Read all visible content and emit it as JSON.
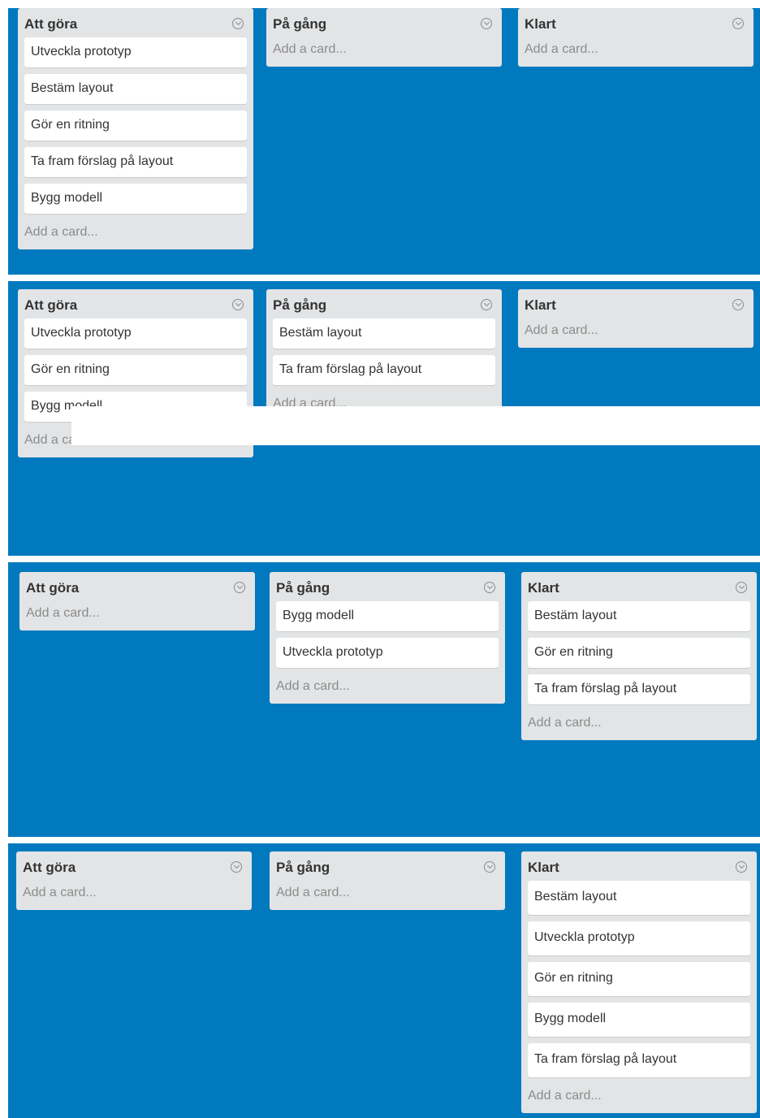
{
  "boards": [
    {
      "lists": [
        {
          "title": "Att göra",
          "cards": [
            "Utveckla prototyp",
            "Bestäm layout",
            "Gör en ritning",
            "Ta fram förslag på layout",
            "Bygg modell"
          ],
          "add": "Add a card..."
        },
        {
          "title": "På gång",
          "cards": [],
          "add": "Add a card..."
        },
        {
          "title": "Klart",
          "cards": [],
          "add": "Add a card..."
        }
      ]
    },
    {
      "lists": [
        {
          "title": "Att göra",
          "cards": [
            "Utveckla prototyp",
            "Gör en ritning",
            "Bygg modell"
          ],
          "add": "Add a card..."
        },
        {
          "title": "På gång",
          "cards": [
            "Bestäm layout",
            "Ta fram förslag på layout"
          ],
          "add": "Add a card..."
        },
        {
          "title": "Klart",
          "cards": [],
          "add": "Add a card..."
        }
      ]
    },
    {
      "lists": [
        {
          "title": "Att göra",
          "cards": [],
          "add": "Add a card..."
        },
        {
          "title": "På gång",
          "cards": [
            "Bygg modell",
            "Utveckla prototyp"
          ],
          "add": "Add a card..."
        },
        {
          "title": "Klart",
          "cards": [
            "Bestäm layout",
            "Gör en ritning",
            "Ta fram förslag på layout"
          ],
          "add": "Add a card..."
        }
      ]
    },
    {
      "lists": [
        {
          "title": "Att göra",
          "cards": [],
          "add": "Add a card..."
        },
        {
          "title": "På gång",
          "cards": [],
          "add": "Add a card..."
        },
        {
          "title": "Klart",
          "cards": [
            "Bestäm layout",
            "Utveckla prototyp",
            "Gör en ritning",
            "Bygg modell",
            "Ta fram förslag på layout"
          ],
          "add": "Add a card..."
        }
      ]
    }
  ],
  "colors": {
    "board_bg": "#0079bf",
    "list_bg": "#e2e4e6",
    "card_bg": "#ffffff"
  }
}
